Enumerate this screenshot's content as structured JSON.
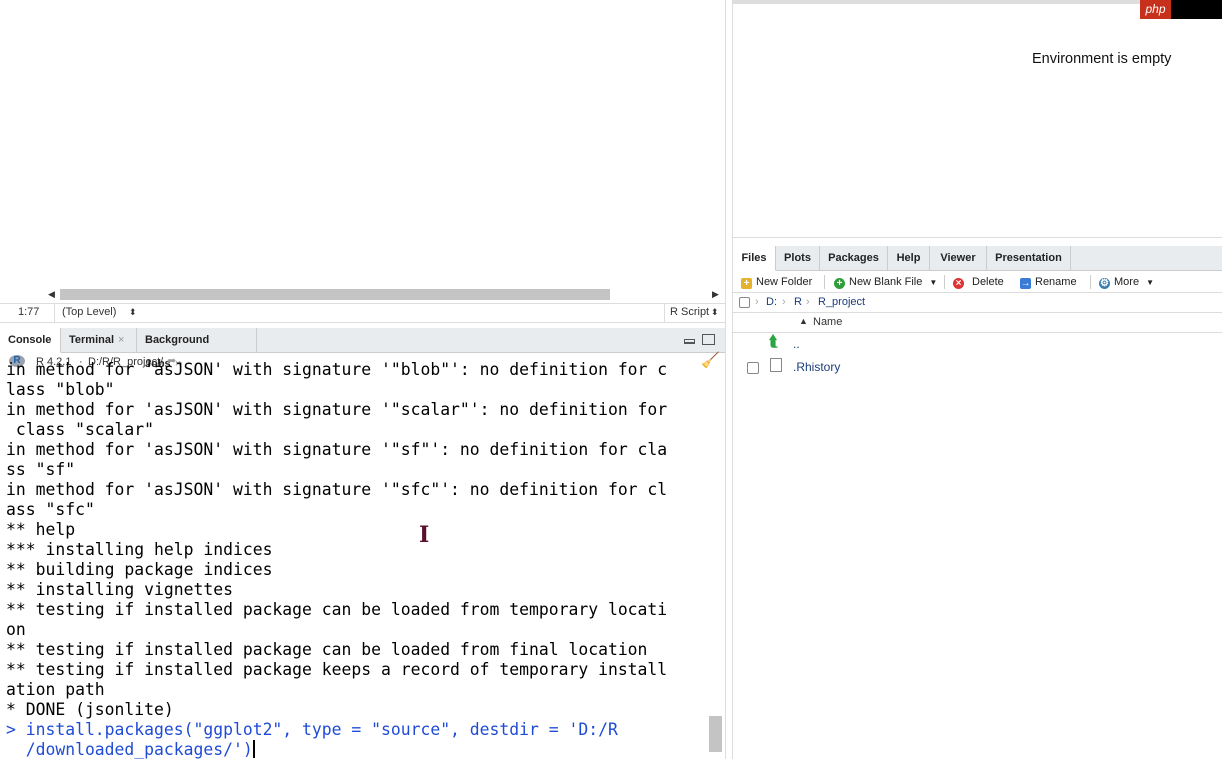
{
  "statusbar": {
    "position": "1:77",
    "scope": "(Top Level)",
    "file_type": "R Script"
  },
  "console": {
    "tabs": [
      {
        "label": "Console"
      },
      {
        "label": "Terminal",
        "close": "×"
      },
      {
        "label": "Background Jobs",
        "close": "×"
      }
    ],
    "r_version": "R 4.2.1",
    "dot": "·",
    "working_dir": "D:/R/R_project/",
    "lines": [
      "in method for 'asJSON' with signature '\"blob\"': no definition for c",
      "lass \"blob\"",
      "in method for 'asJSON' with signature '\"scalar\"': no definition for",
      " class \"scalar\"",
      "in method for 'asJSON' with signature '\"sf\"': no definition for cla",
      "ss \"sf\"",
      "in method for 'asJSON' with signature '\"sfc\"': no definition for cl",
      "ass \"sfc\"",
      "** help",
      "*** installing help indices",
      "** building package indices",
      "** installing vignettes",
      "** testing if installed package can be loaded from temporary locati",
      "on",
      "** testing if installed package can be loaded from final location",
      "** testing if installed package keeps a record of temporary install",
      "ation path",
      "* DONE (jsonlite)"
    ],
    "command_line1": "> install.packages(\"ggplot2\", type = \"source\", destdir = 'D:/R",
    "command_line2": "  /downloaded_packages/')"
  },
  "environment": {
    "empty_message": "Environment is empty"
  },
  "watermark": "php",
  "files_pane": {
    "tabs": [
      "Files",
      "Plots",
      "Packages",
      "Help",
      "Viewer",
      "Presentation"
    ],
    "toolbar": {
      "new_folder": "New Folder",
      "new_blank_file": "New Blank File",
      "delete": "Delete",
      "rename": "Rename",
      "more": "More"
    },
    "breadcrumb": [
      "D:",
      "R",
      "R_project"
    ],
    "column_name": "Name",
    "entries": [
      {
        "name": ".."
      },
      {
        "name": ".Rhistory"
      }
    ]
  },
  "colors": {
    "command_text": "#1f4bd6",
    "link": "#1a3d7c",
    "tab_bar": "#e9ecef"
  }
}
